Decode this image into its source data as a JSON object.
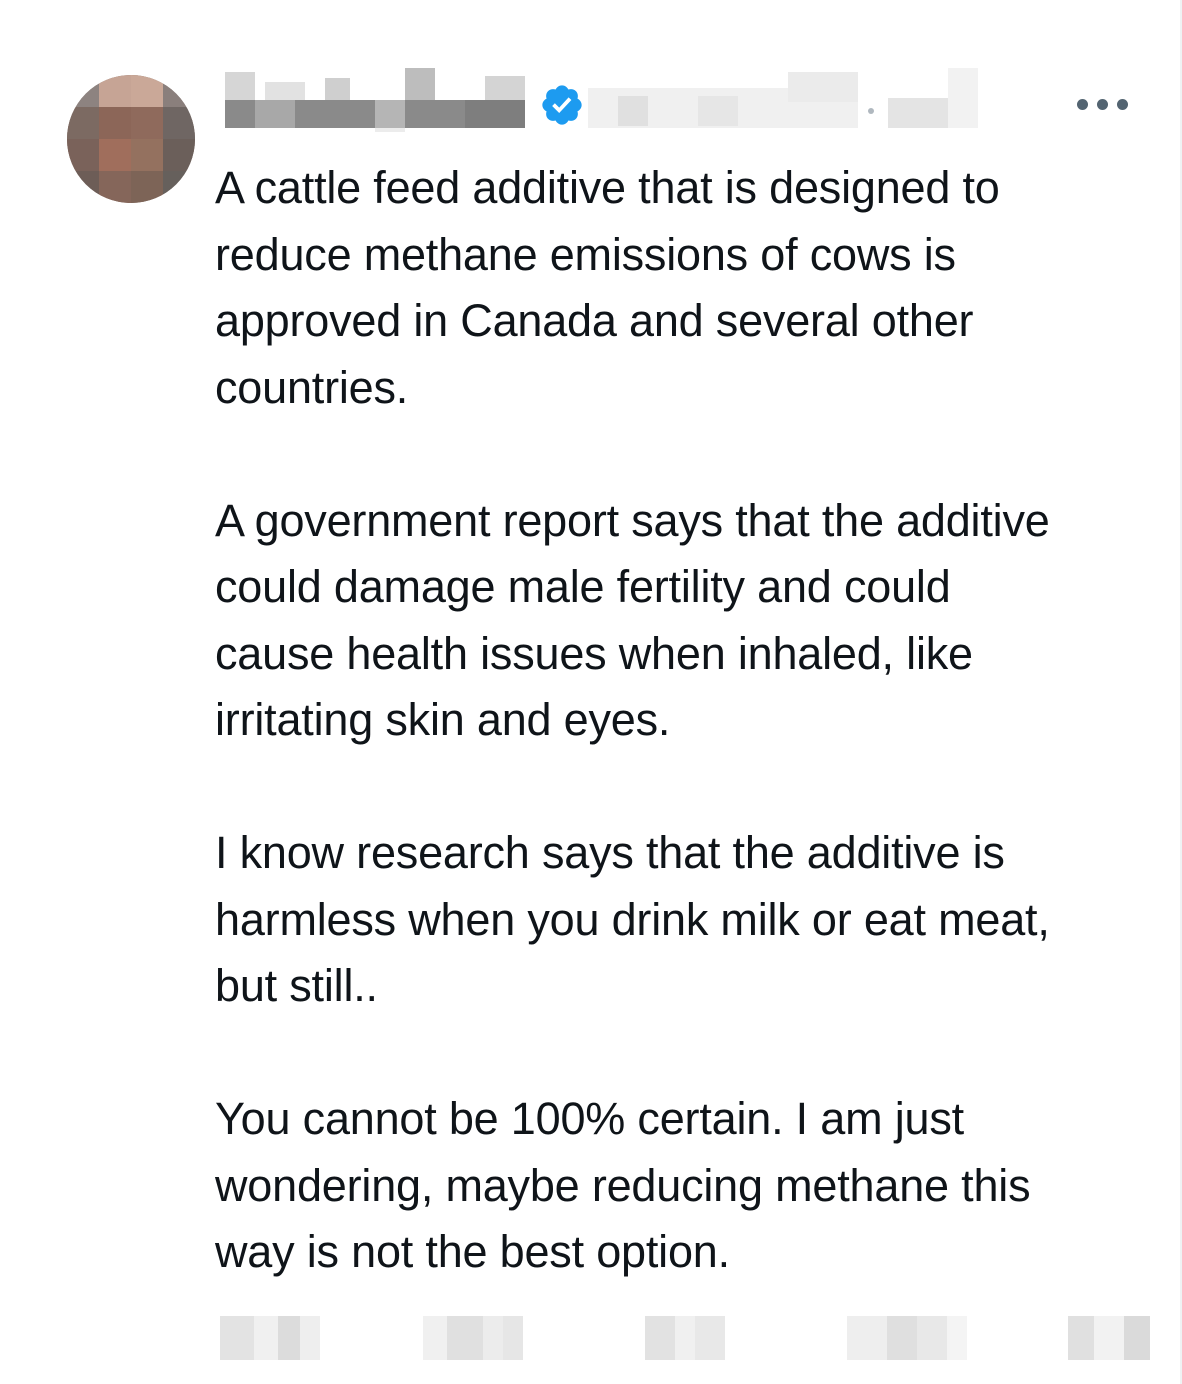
{
  "tweet": {
    "author": {
      "avatar_icon": "avatar-pixelated",
      "display_name": "",
      "verified_badge": "verified-badge-icon",
      "verified_color": "#1d9bf0",
      "handle_and_time": ""
    },
    "more_icon": "more-horizontal-icon",
    "paragraphs": [
      "A cattle feed additive that is designed to\nreduce methane emissions of cows is\napproved in Canada and several other\ncountries.",
      "A government report says that the additive\ncould damage male fertility and could\ncause health issues when inhaled, like\nirritating skin and eyes.",
      "I know research says that the additive is\nharmless when you drink milk or eat meat,\nbut still..",
      "You cannot be 100% certain. I am just\nwondering, maybe reducing methane this\nway is not the best option."
    ],
    "actions": [
      {
        "name": "reply-action",
        "icon": "reply-icon"
      },
      {
        "name": "retweet-action",
        "icon": "retweet-icon"
      },
      {
        "name": "like-action",
        "icon": "like-icon"
      },
      {
        "name": "views-action",
        "icon": "views-icon"
      },
      {
        "name": "share-action",
        "icon": "share-icon"
      }
    ]
  }
}
